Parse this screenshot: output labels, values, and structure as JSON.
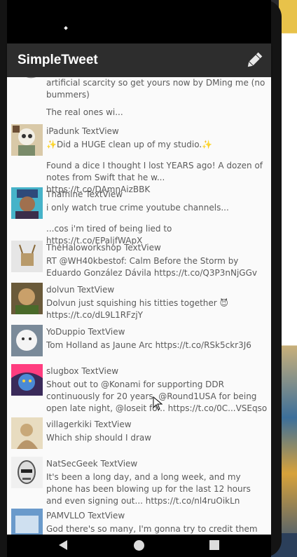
{
  "app": {
    "title": "SimpleTweet",
    "compose_icon": "pencil-icon"
  },
  "tweets": [
    {
      "name": "",
      "handle": "",
      "body": "artificial scarcity so get yours now by DMing me (no bummers)"
    },
    {
      "name": "",
      "handle": "",
      "body": "The real ones wi..."
    },
    {
      "name": "iPadunk",
      "handle": "TextView",
      "body": "✨Did a HUGE clean up of my studio.✨"
    },
    {
      "name": "",
      "handle": "",
      "body": "Found a dice I thought I lost YEARS ago! A dozen of notes from Swift that he w... https://t.co/DAmnAizBBK"
    },
    {
      "name": "Thafnine",
      "handle": "TextView",
      "body": "i only watch true crime youtube channels..."
    },
    {
      "name": "",
      "handle": "",
      "body": "...cos i'm tired of being lied to https://t.co/EPaljfWApX"
    },
    {
      "name": "TheHaloworkshop",
      "handle": "TextView",
      "body": "RT @WH40kbestof: Calm Before the Storm by Eduardo González Dávila https://t.co/Q3P3nNjGGv"
    },
    {
      "name": "dolvun",
      "handle": "TextView",
      "body": "Dolvun just squishing his titties together 😈 https://t.co/dL9L1RFzjY"
    },
    {
      "name": "YoDuppio",
      "handle": "TextView",
      "body": "Tom Holland as Jaune Arc https://t.co/RSk5ckr3J6"
    },
    {
      "name": "slugbox",
      "handle": "TextView",
      "body": "Shout out to @Konami for supporting DDR continuously for 20 years, @Round1USA for being open late night, @loseit fo... https://t.co/0C...VSEqso"
    },
    {
      "name": "villagerkiki",
      "handle": "TextView",
      "body": "Which ship should I draw"
    },
    {
      "name": "NatSecGeek",
      "handle": "TextView",
      "body": "It's been a long day, and a long week, and my phone has been blowing up for the last 12 hours and even signing out... https://t.co/nl4ruOikLn"
    },
    {
      "name": "PAMVLLO",
      "handle": "TextView",
      "body": "God there's so many, I'm gonna try to credit them all if"
    }
  ],
  "navigation": {
    "back_icon": "back-triangle-icon",
    "home_icon": "home-circle-icon",
    "recent_icon": "recent-apps-square-icon"
  }
}
